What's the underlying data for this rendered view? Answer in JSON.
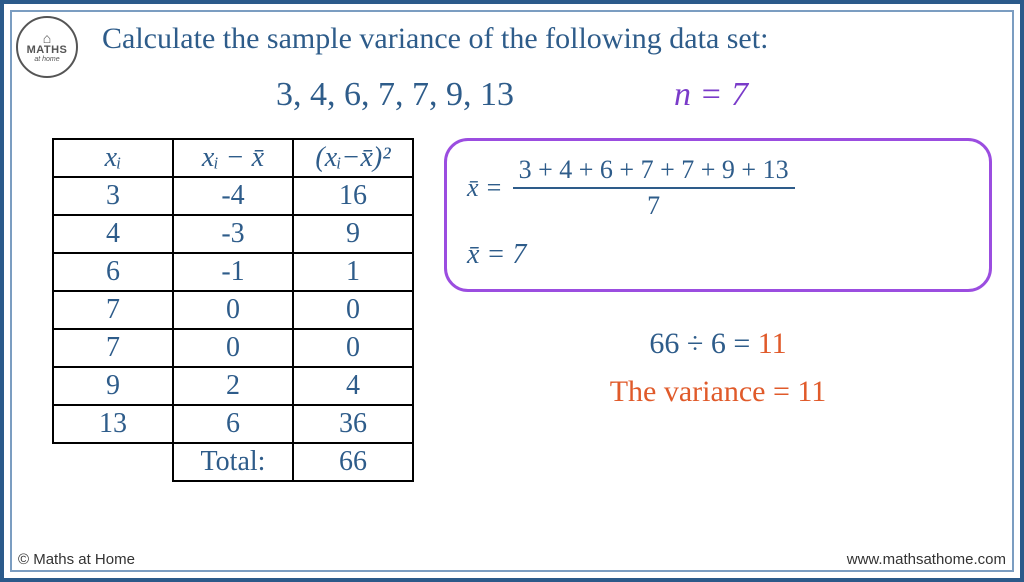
{
  "logo": {
    "top": "⌂",
    "line1": "MATHS",
    "line2": "at home"
  },
  "title": "Calculate the sample variance of the following data set:",
  "data_set": "3, 4, 6, 7, 7, 9, 13",
  "n_label": "n = 7",
  "table": {
    "headers": [
      "xᵢ",
      "xᵢ − x̄",
      "(xᵢ−x̄)²"
    ],
    "rows": [
      [
        "3",
        "-4",
        "16"
      ],
      [
        "4",
        "-3",
        "9"
      ],
      [
        "6",
        "-1",
        "1"
      ],
      [
        "7",
        "0",
        "0"
      ],
      [
        "7",
        "0",
        "0"
      ],
      [
        "9",
        "2",
        "4"
      ],
      [
        "13",
        "6",
        "36"
      ]
    ],
    "total_label": "Total:",
    "total_value": "66"
  },
  "mean": {
    "lhs": "x̄ =",
    "numerator": "3 + 4 + 6 + 7 + 7 + 9 + 13",
    "denominator": "7",
    "result": "x̄ = 7"
  },
  "calc": {
    "line1a": "66 ÷ 6 = ",
    "line1b": "11",
    "line2": "The variance = 11"
  },
  "footer": {
    "left": "© Maths at Home",
    "right": "www.mathsathome.com"
  }
}
